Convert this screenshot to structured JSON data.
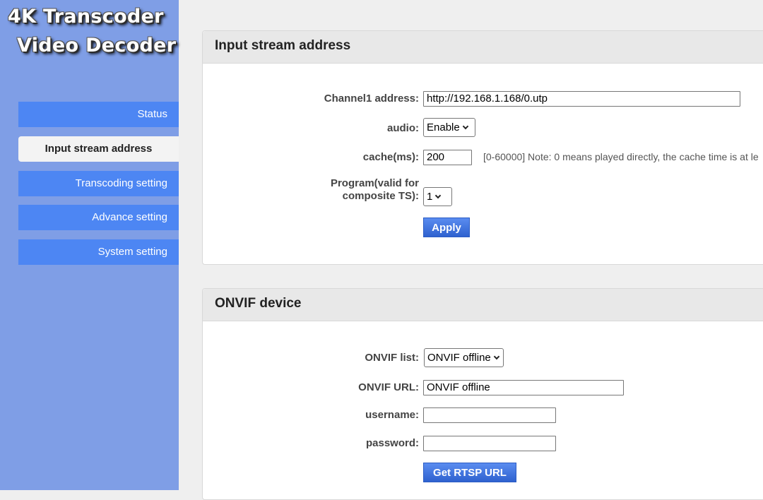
{
  "app": {
    "logo_line1": "4K Transcoder",
    "logo_line2": "Video Decoder"
  },
  "sidebar": {
    "items": [
      {
        "label": "Status"
      },
      {
        "label": "Input stream address"
      },
      {
        "label": "Transcoding setting"
      },
      {
        "label": "Advance setting"
      },
      {
        "label": "System setting"
      }
    ],
    "active": "Input stream address"
  },
  "input_panel": {
    "title": "Input stream address",
    "channel1_label": "Channel1 address:",
    "channel1_value": "http://192.168.1.168/0.utp",
    "audio_label": "audio:",
    "audio_value": "Enable",
    "cache_label": "cache(ms):",
    "cache_value": "200",
    "cache_hint": "[0-60000]  Note: 0 means played directly, the cache time is at le",
    "program_label_line1": "Program(valid for",
    "program_label_line2": "composite TS):",
    "program_value": "1",
    "apply_label": "Apply"
  },
  "onvif_panel": {
    "title": "ONVIF device",
    "list_label": "ONVIF list:",
    "list_value": "ONVIF offline",
    "url_label": "ONVIF URL:",
    "url_value": "ONVIF offline",
    "username_label": "username:",
    "username_value": "",
    "password_label": "password:",
    "password_value": "",
    "get_rtsp_label": "Get RTSP URL"
  },
  "colors": {
    "sidebar_bg": "#7f9ee6",
    "nav_item_bg": "#4d86f3",
    "button_bg": "#3f72dd",
    "page_bg": "#efefef"
  }
}
